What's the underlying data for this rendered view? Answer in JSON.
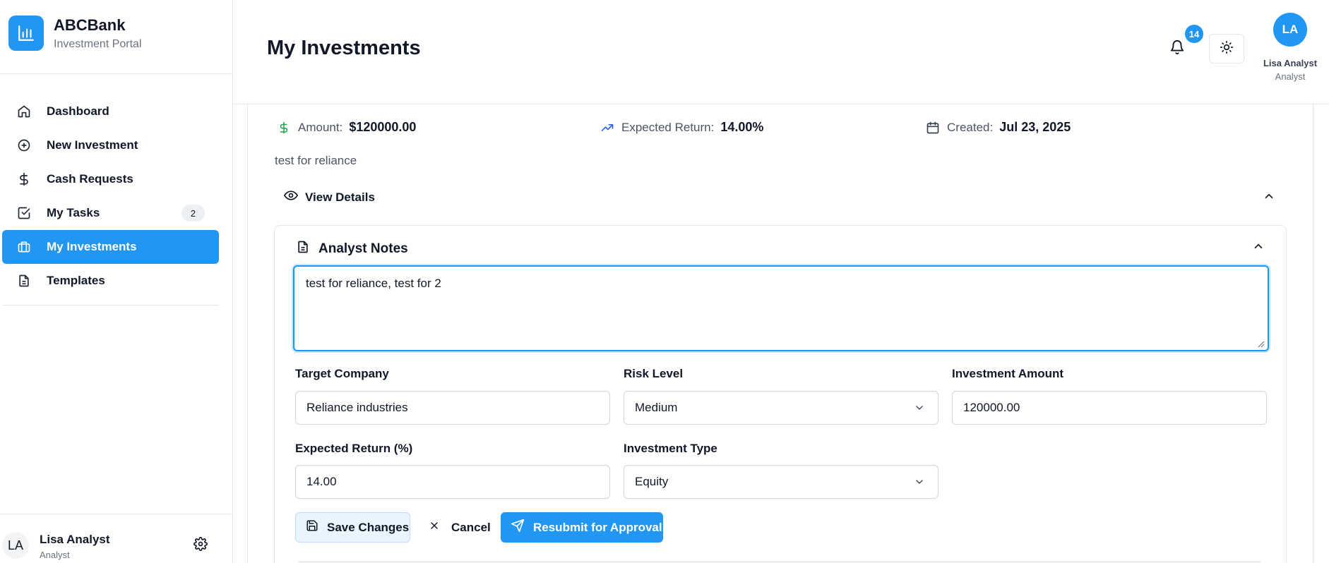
{
  "brand": {
    "name": "ABCBank",
    "subtitle": "Investment Portal"
  },
  "sidebar": {
    "items": [
      {
        "label": "Dashboard",
        "icon": "home-icon"
      },
      {
        "label": "New Investment",
        "icon": "plus-circle-icon"
      },
      {
        "label": "Cash Requests",
        "icon": "dollar-icon"
      },
      {
        "label": "My Tasks",
        "icon": "check-square-icon",
        "badge": "2"
      },
      {
        "label": "My Investments",
        "icon": "briefcase-icon",
        "active": true
      },
      {
        "label": "Templates",
        "icon": "document-icon"
      }
    ],
    "footer": {
      "initials": "LA",
      "name": "Lisa Analyst",
      "role": "Analyst"
    }
  },
  "header": {
    "title": "My Investments",
    "notification_count": "14",
    "user": {
      "initials": "LA",
      "name": "Lisa Analyst",
      "role": "Analyst"
    }
  },
  "investment": {
    "amount_label": "Amount:",
    "amount_value": "$120000.00",
    "return_label": "Expected Return:",
    "return_value": "14.00%",
    "created_label": "Created:",
    "created_value": "Jul 23, 2025",
    "description": "test for reliance",
    "view_details_label": "View Details"
  },
  "notes": {
    "title": "Analyst Notes",
    "text": "test for reliance, test for 2"
  },
  "form": {
    "target_company": {
      "label": "Target Company",
      "value": "Reliance industries"
    },
    "risk_level": {
      "label": "Risk Level",
      "value": "Medium"
    },
    "investment_amount": {
      "label": "Investment Amount",
      "value": "120000.00"
    },
    "expected_return": {
      "label": "Expected Return (%)",
      "value": "14.00"
    },
    "investment_type": {
      "label": "Investment Type",
      "value": "Equity"
    }
  },
  "actions": {
    "save_label": "Save Changes",
    "cancel_label": "Cancel",
    "resubmit_label": "Resubmit for Approval"
  },
  "colors": {
    "accent": "#2196f3",
    "amount_icon": "#16a34a",
    "return_icon": "#2563eb"
  }
}
